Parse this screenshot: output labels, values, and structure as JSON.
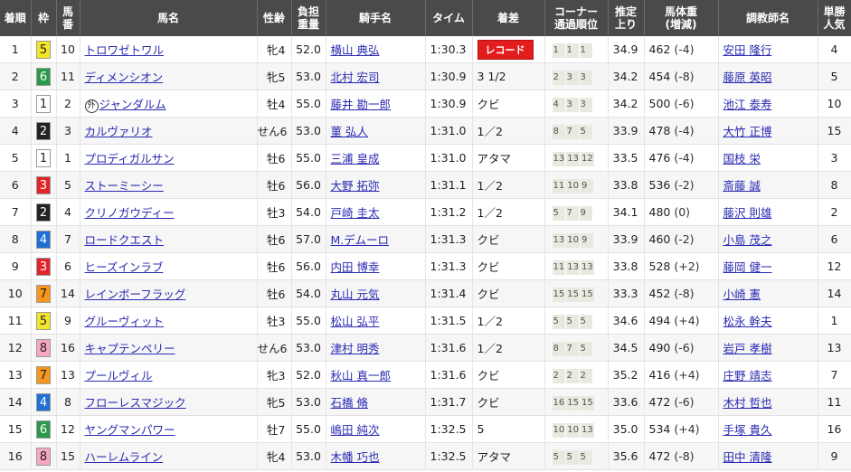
{
  "headers": {
    "rank": "着順",
    "waku": "枠",
    "umaban": "馬番",
    "horse": "馬名",
    "sexage": "性齢",
    "weight": "負担重量",
    "jockey": "騎手名",
    "time": "タイム",
    "margin": "着差",
    "corner": "コーナー通過順位",
    "last3f": "推定上り",
    "bodyweight": "馬体重(増減)",
    "trainer": "調教師名",
    "pop": "単勝人気"
  },
  "colors": {
    "waku_1": "#ffffff",
    "waku_2": "#222222",
    "waku_3": "#e0252a",
    "waku_4": "#1f6fd6",
    "waku_5": "#f5e52a",
    "waku_6": "#2a9a4a",
    "waku_7": "#f5961e",
    "waku_8": "#f7a7c4",
    "header_bg": "#4a4a4a",
    "link": "#2a2ab3",
    "record_badge": "#e31d1d"
  },
  "rows": [
    {
      "rank": "1",
      "waku": "5",
      "umaban": "10",
      "horse": "トロワゼトワル",
      "mark": "",
      "sexage": "牝4",
      "weight": "52.0",
      "jockey": "横山 典弘",
      "time": "1:30.3",
      "margin": "レコード",
      "record": true,
      "corner": [
        "1",
        "1",
        "1"
      ],
      "last3f": "34.9",
      "bw": "462",
      "bwdiff": "(-4)",
      "trainer": "安田 隆行",
      "pop": "4"
    },
    {
      "rank": "2",
      "waku": "6",
      "umaban": "11",
      "horse": "ディメンシオン",
      "mark": "",
      "sexage": "牝5",
      "weight": "53.0",
      "jockey": "北村 宏司",
      "time": "1:30.9",
      "margin": "3 1/2",
      "record": false,
      "corner": [
        "2",
        "3",
        "3"
      ],
      "last3f": "34.2",
      "bw": "454",
      "bwdiff": "(-8)",
      "trainer": "藤原 英昭",
      "pop": "5"
    },
    {
      "rank": "3",
      "waku": "1",
      "umaban": "2",
      "horse": "ジャンダルム",
      "mark": "外",
      "sexage": "牡4",
      "weight": "55.0",
      "jockey": "藤井 勘一郎",
      "time": "1:30.9",
      "margin": "クビ",
      "record": false,
      "corner": [
        "4",
        "3",
        "3"
      ],
      "last3f": "34.2",
      "bw": "500",
      "bwdiff": "(-6)",
      "trainer": "池江 泰寿",
      "pop": "10"
    },
    {
      "rank": "4",
      "waku": "2",
      "umaban": "3",
      "horse": "カルヴァリオ",
      "mark": "",
      "sexage": "せん6",
      "weight": "53.0",
      "jockey": "菫 弘人",
      "time": "1:31.0",
      "margin": "1／2",
      "record": false,
      "corner": [
        "8",
        "7",
        "5"
      ],
      "last3f": "33.9",
      "bw": "478",
      "bwdiff": "(-4)",
      "trainer": "大竹 正博",
      "pop": "15"
    },
    {
      "rank": "5",
      "waku": "1",
      "umaban": "1",
      "horse": "プロディガルサン",
      "mark": "",
      "sexage": "牡6",
      "weight": "55.0",
      "jockey": "三浦 皇成",
      "time": "1:31.0",
      "margin": "アタマ",
      "record": false,
      "corner": [
        "13",
        "13",
        "12"
      ],
      "last3f": "33.5",
      "bw": "476",
      "bwdiff": "(-4)",
      "trainer": "国枝 栄",
      "pop": "3"
    },
    {
      "rank": "6",
      "waku": "3",
      "umaban": "5",
      "horse": "ストーミーシー",
      "mark": "",
      "sexage": "牡6",
      "weight": "56.0",
      "jockey": "大野 拓弥",
      "time": "1:31.1",
      "margin": "1／2",
      "record": false,
      "corner": [
        "11",
        "10",
        "9"
      ],
      "last3f": "33.8",
      "bw": "536",
      "bwdiff": "(-2)",
      "trainer": "斎藤 誠",
      "pop": "8"
    },
    {
      "rank": "7",
      "waku": "2",
      "umaban": "4",
      "horse": "クリノガウディー",
      "mark": "",
      "sexage": "牡3",
      "weight": "54.0",
      "jockey": "戸崎 圭太",
      "time": "1:31.2",
      "margin": "1／2",
      "record": false,
      "corner": [
        "5",
        "7",
        "9"
      ],
      "last3f": "34.1",
      "bw": "480",
      "bwdiff": "(0)",
      "trainer": "藤沢 則雄",
      "pop": "2"
    },
    {
      "rank": "8",
      "waku": "4",
      "umaban": "7",
      "horse": "ロードクエスト",
      "mark": "",
      "sexage": "牡6",
      "weight": "57.0",
      "jockey": "M.デムーロ",
      "time": "1:31.3",
      "margin": "クビ",
      "record": false,
      "corner": [
        "13",
        "10",
        "9"
      ],
      "last3f": "33.9",
      "bw": "460",
      "bwdiff": "(-2)",
      "trainer": "小島 茂之",
      "pop": "6"
    },
    {
      "rank": "9",
      "waku": "3",
      "umaban": "6",
      "horse": "ヒーズインラブ",
      "mark": "",
      "sexage": "牡6",
      "weight": "56.0",
      "jockey": "内田 博幸",
      "time": "1:31.3",
      "margin": "クビ",
      "record": false,
      "corner": [
        "11",
        "13",
        "13"
      ],
      "last3f": "33.8",
      "bw": "528",
      "bwdiff": "(+2)",
      "trainer": "藤岡 健一",
      "pop": "12"
    },
    {
      "rank": "10",
      "waku": "7",
      "umaban": "14",
      "horse": "レインボーフラッグ",
      "mark": "",
      "sexage": "牡6",
      "weight": "54.0",
      "jockey": "丸山 元気",
      "time": "1:31.4",
      "margin": "クビ",
      "record": false,
      "corner": [
        "15",
        "15",
        "15"
      ],
      "last3f": "33.3",
      "bw": "452",
      "bwdiff": "(-8)",
      "trainer": "小崎 憲",
      "pop": "14"
    },
    {
      "rank": "11",
      "waku": "5",
      "umaban": "9",
      "horse": "グルーヴィット",
      "mark": "",
      "sexage": "牡3",
      "weight": "55.0",
      "jockey": "松山 弘平",
      "time": "1:31.5",
      "margin": "1／2",
      "record": false,
      "corner": [
        "5",
        "5",
        "5"
      ],
      "last3f": "34.6",
      "bw": "494",
      "bwdiff": "(+4)",
      "trainer": "松永 幹夫",
      "pop": "1"
    },
    {
      "rank": "12",
      "waku": "8",
      "umaban": "16",
      "horse": "キャプテンペリー",
      "mark": "",
      "sexage": "せん6",
      "weight": "53.0",
      "jockey": "津村 明秀",
      "time": "1:31.6",
      "margin": "1／2",
      "record": false,
      "corner": [
        "8",
        "7",
        "5"
      ],
      "last3f": "34.5",
      "bw": "490",
      "bwdiff": "(-6)",
      "trainer": "岩戸 孝樹",
      "pop": "13"
    },
    {
      "rank": "13",
      "waku": "7",
      "umaban": "13",
      "horse": "プールヴィル",
      "mark": "",
      "sexage": "牝3",
      "weight": "52.0",
      "jockey": "秋山 真一郎",
      "time": "1:31.6",
      "margin": "クビ",
      "record": false,
      "corner": [
        "2",
        "2",
        "2"
      ],
      "last3f": "35.2",
      "bw": "416",
      "bwdiff": "(+4)",
      "trainer": "庄野 靖志",
      "pop": "7"
    },
    {
      "rank": "14",
      "waku": "4",
      "umaban": "8",
      "horse": "フローレスマジック",
      "mark": "",
      "sexage": "牝5",
      "weight": "53.0",
      "jockey": "石橋 脩",
      "time": "1:31.7",
      "margin": "クビ",
      "record": false,
      "corner": [
        "16",
        "15",
        "15"
      ],
      "last3f": "33.6",
      "bw": "472",
      "bwdiff": "(-6)",
      "trainer": "木村 哲也",
      "pop": "11"
    },
    {
      "rank": "15",
      "waku": "6",
      "umaban": "12",
      "horse": "ヤングマンパワー",
      "mark": "",
      "sexage": "牡7",
      "weight": "55.0",
      "jockey": "嶋田 純次",
      "time": "1:32.5",
      "margin": "5",
      "record": false,
      "corner": [
        "10",
        "10",
        "13"
      ],
      "last3f": "35.0",
      "bw": "534",
      "bwdiff": "(+4)",
      "trainer": "手塚 貴久",
      "pop": "16"
    },
    {
      "rank": "16",
      "waku": "8",
      "umaban": "15",
      "horse": "ハーレムライン",
      "mark": "",
      "sexage": "牝4",
      "weight": "53.0",
      "jockey": "木幡 巧也",
      "time": "1:32.5",
      "margin": "アタマ",
      "record": false,
      "corner": [
        "5",
        "5",
        "5"
      ],
      "last3f": "35.6",
      "bw": "472",
      "bwdiff": "(-8)",
      "trainer": "田中 清隆",
      "pop": "9"
    }
  ]
}
